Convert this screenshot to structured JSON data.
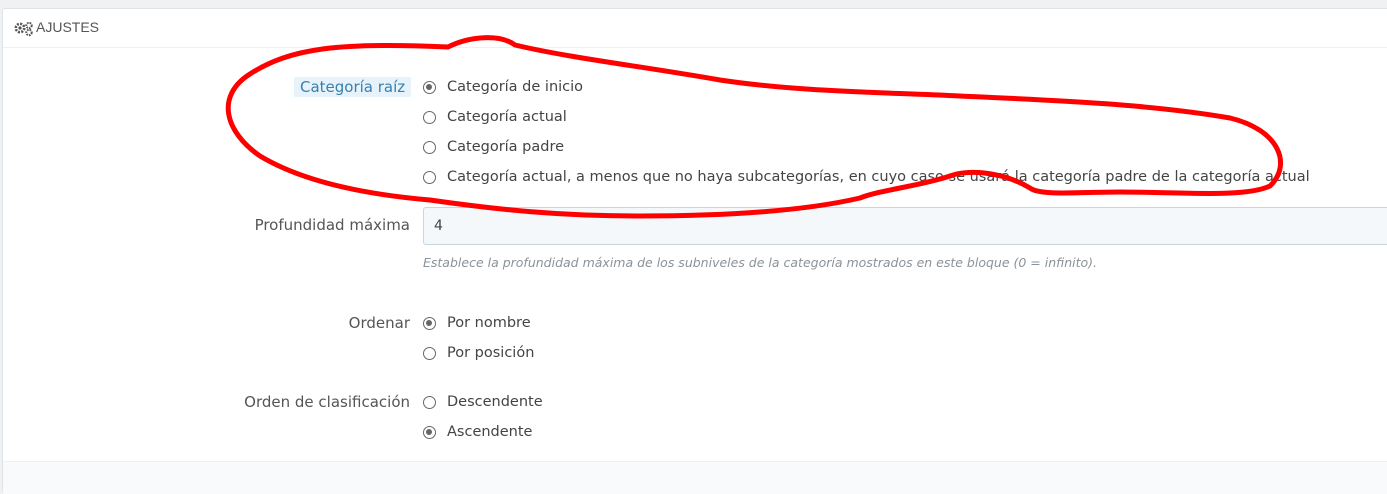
{
  "panel": {
    "title": "AJUSTES",
    "icon": "gears-icon"
  },
  "root_category": {
    "label": "Categoría raíz",
    "options": [
      {
        "label": "Categoría de inicio",
        "checked": true
      },
      {
        "label": "Categoría actual",
        "checked": false
      },
      {
        "label": "Categoría padre",
        "checked": false
      },
      {
        "label": "Categoría actual, a menos que no haya subcategorías, en cuyo caso se usará la categoría padre de la categoría actual",
        "checked": false
      }
    ]
  },
  "max_depth": {
    "label": "Profundidad máxima",
    "value": "4",
    "help": "Establece la profundidad máxima de los subniveles de la categoría mostrados en este bloque (0 = infinito)."
  },
  "sort": {
    "label": "Ordenar",
    "options": [
      {
        "label": "Por nombre",
        "checked": true
      },
      {
        "label": "Por posición",
        "checked": false
      }
    ]
  },
  "sort_order": {
    "label": "Orden de clasificación",
    "options": [
      {
        "label": "Descendente",
        "checked": false
      },
      {
        "label": "Ascendente",
        "checked": true
      }
    ]
  },
  "colors": {
    "annotation": "#ff0000",
    "highlight_bg": "#e6f3fa",
    "highlight_text": "#3a7fae"
  }
}
